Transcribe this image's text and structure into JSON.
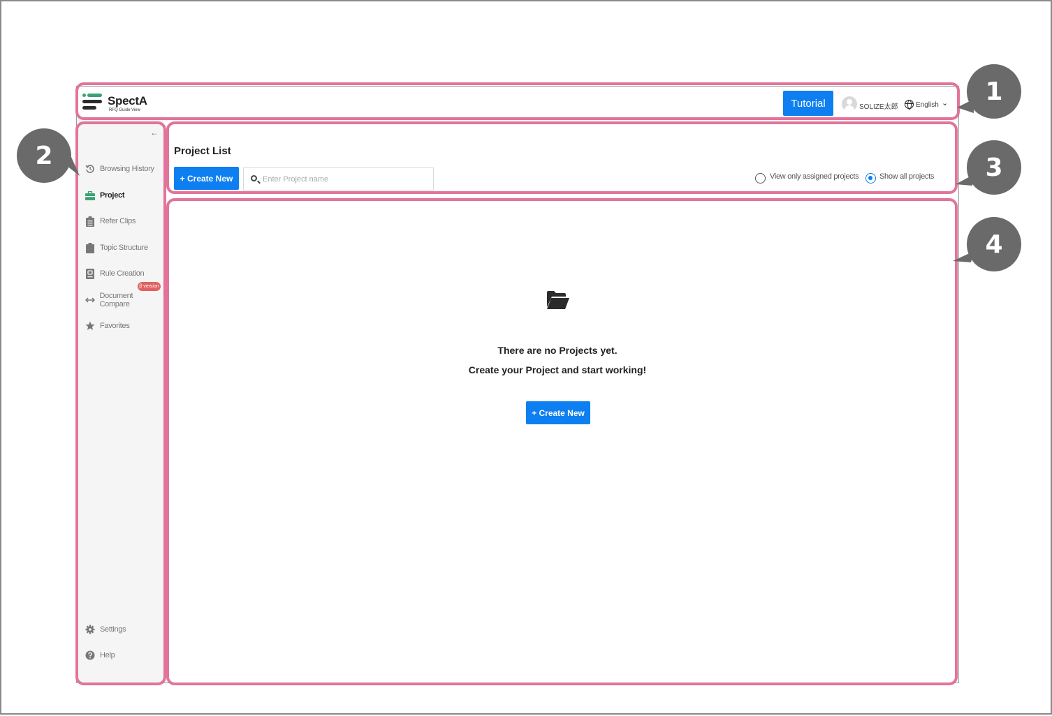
{
  "app": {
    "name": "SpectA",
    "subtitle": "RFQ Guide View",
    "logo_colors": {
      "green": "#3aa374",
      "dark": "#2b2b2b"
    }
  },
  "header": {
    "tutorial_label": "Tutorial",
    "user_name": "SOLIZE太郎",
    "language": "English",
    "language_chevron": "⌄"
  },
  "sidebar": {
    "collapse_label": "←",
    "items": [
      {
        "label": "Browsing History",
        "icon": "history-icon"
      },
      {
        "label": "Project",
        "icon": "briefcase-icon",
        "active": true
      },
      {
        "label": "Refer Clips",
        "icon": "clipboard-list-icon"
      },
      {
        "label": "Topic Structure",
        "icon": "clipboard-icon"
      },
      {
        "label": "Rule Creation",
        "icon": "rule-book-icon"
      },
      {
        "label": "Document Compare",
        "icon": "arrows-horizontal-icon"
      },
      {
        "label": "Favorites",
        "icon": "star-icon"
      }
    ],
    "beta_badge": "β version",
    "bottom_items": [
      {
        "label": "Settings",
        "icon": "gear-icon"
      },
      {
        "label": "Help",
        "icon": "question-icon"
      }
    ]
  },
  "main": {
    "title": "Project List",
    "create_new_label": "+ Create New",
    "search_placeholder": "Enter Project name",
    "filter_options": [
      {
        "label": "View only assigned projects",
        "checked": false
      },
      {
        "label": "Show all projects",
        "checked": true
      }
    ],
    "empty_state": {
      "line1": "There are no Projects yet.",
      "line2": "Create your Project and start working!",
      "button_label": "+ Create New"
    }
  },
  "annotations": {
    "marker_color": "#e2749b",
    "circle_color": "#6a6a6a",
    "labels": [
      "1",
      "2",
      "3",
      "4"
    ]
  }
}
